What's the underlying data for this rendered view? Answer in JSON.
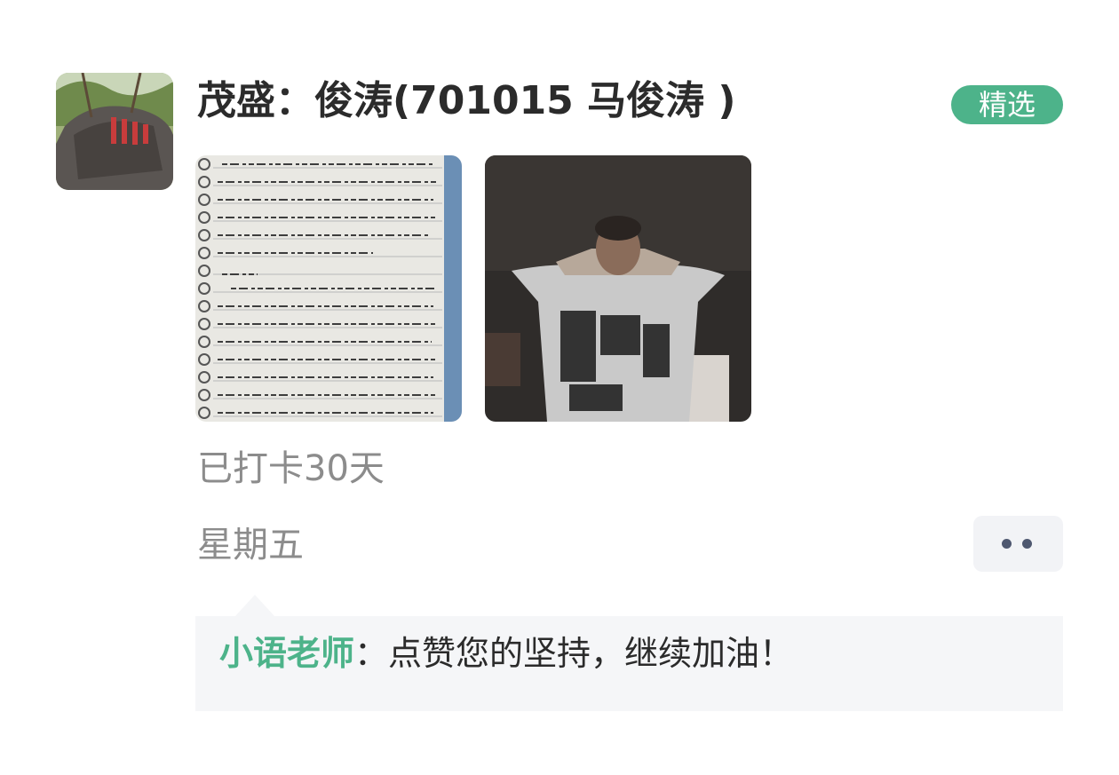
{
  "post": {
    "title": "茂盛：俊涛(701015 马俊涛 )",
    "badge": "精选",
    "streak": "已打卡30天",
    "weekday": "星期五"
  },
  "comment": {
    "author": "小语老师",
    "separator": "：",
    "text": "点赞您的坚持，继续加油！"
  },
  "colors": {
    "accent": "#4db38a",
    "muted_text": "#8c8c8c",
    "comment_bg": "#f5f6f8"
  },
  "icons": {
    "more": "more-dots-icon"
  }
}
